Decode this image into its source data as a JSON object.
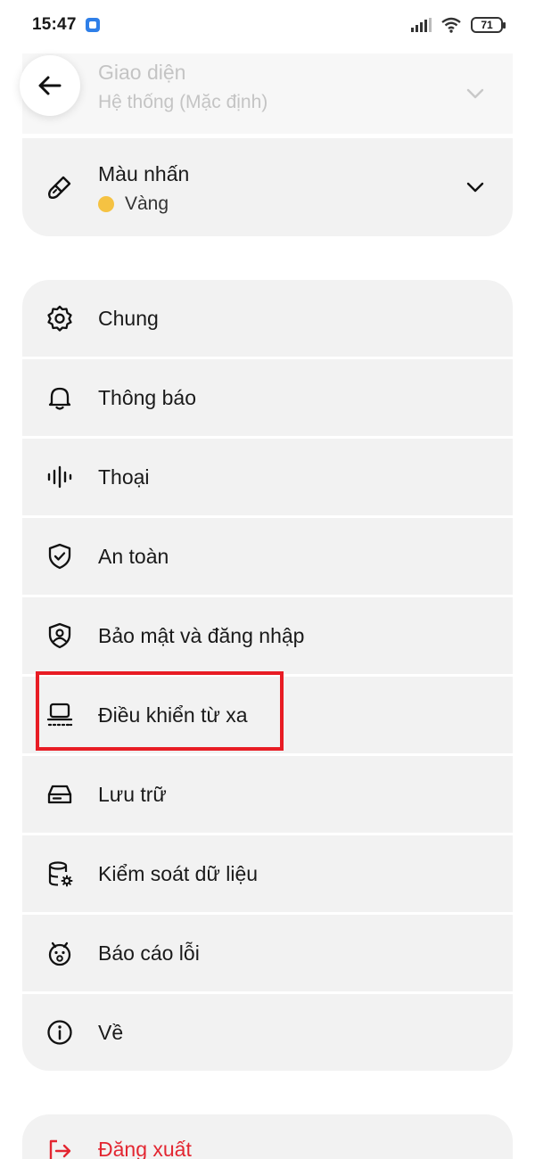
{
  "status_bar": {
    "time": "15:47",
    "battery": "71"
  },
  "appearance": {
    "title": "Giao diện",
    "value": "Hệ thống (Mặc định)"
  },
  "accent": {
    "title": "Màu nhấn",
    "value": "Vàng",
    "color": "#f5c242"
  },
  "menu": {
    "general": "Chung",
    "notifications": "Thông báo",
    "voice": "Thoại",
    "safety": "An toàn",
    "security": "Bảo mật và đăng nhập",
    "remote": "Điều khiển từ xa",
    "storage": "Lưu trữ",
    "data_control": "Kiểm soát dữ liệu",
    "bug_report": "Báo cáo lỗi",
    "about": "Về"
  },
  "logout": {
    "label": "Đăng xuất",
    "color": "#e32631"
  },
  "highlight_color": "#e81c24"
}
